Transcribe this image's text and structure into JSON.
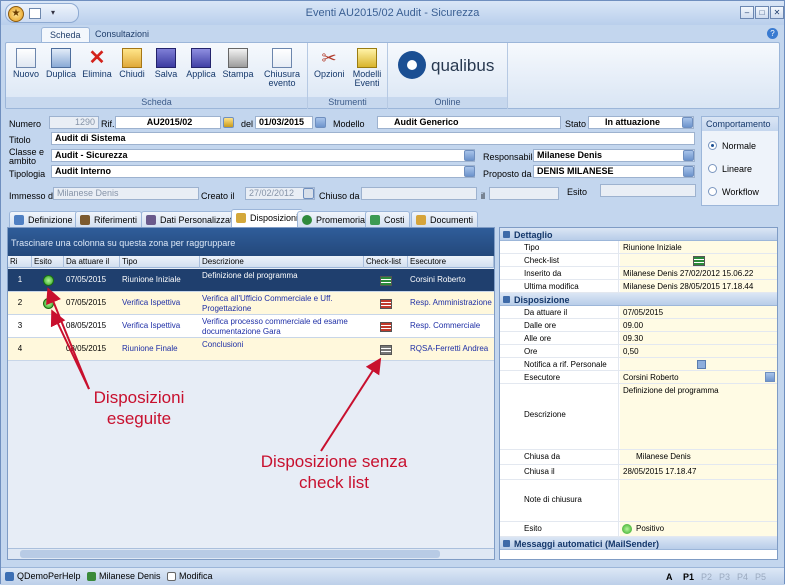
{
  "window": {
    "title": "Eventi AU2015/02 Audit - Sicurezza"
  },
  "ribbon_tabs": [
    "Scheda",
    "Consultazioni"
  ],
  "ribbon": {
    "groups": [
      {
        "label": "Scheda",
        "buttons": [
          "Nuovo",
          "Duplica",
          "Elimina",
          "Chiudi",
          "Salva",
          "Applica",
          "Stampa",
          "Chiusura evento"
        ]
      },
      {
        "label": "Strumenti",
        "buttons": [
          "Opzioni",
          "Modelli Eventi"
        ]
      },
      {
        "label": "Online"
      }
    ],
    "logo_text": "qualibus"
  },
  "form": {
    "numero_label": "Numero",
    "numero": "1290",
    "rif_label": "Rif.",
    "rif": "AU2015/02",
    "del_label": "del",
    "del": "01/03/2015",
    "modello_label": "Modello",
    "modello": "Audit Generico",
    "stato_label": "Stato",
    "stato": "In attuazione",
    "titolo_label": "Titolo",
    "titolo": "Audit di Sistema",
    "classe_label": "Classe e ambito",
    "classe": "Audit - Sicurezza",
    "tipologia_label": "Tipologia",
    "tipologia": "Audit Interno",
    "responsabile_label": "Responsabile",
    "responsabile": "Milanese Denis",
    "proposto_label": "Proposto da",
    "proposto": "DENIS MILANESE",
    "immesso_label": "Immesso da",
    "immesso": "Milanese Denis",
    "creato_label": "Creato il",
    "creato": "27/02/2012",
    "chiuso_label": "Chiuso da",
    "chiuso": "",
    "il_label": "il",
    "il": "",
    "esito_label": "Esito",
    "esito": ""
  },
  "comportamento": {
    "title": "Comportamento",
    "options": [
      "Normale",
      "Lineare",
      "Workflow"
    ],
    "selected": "Normale"
  },
  "page_tabs": [
    "Definizione",
    "Riferimenti",
    "Dati Personalizzati",
    "Disposizioni",
    "Promemoria",
    "Costi",
    "Documenti"
  ],
  "active_tab": "Disposizioni",
  "grid": {
    "group_hint": "Trascinare una colonna su questa zona per raggruppare",
    "headers": [
      "Ri",
      "Esito",
      "Da attuare il",
      "Tipo",
      "Descrizione",
      "Check-list",
      "Esecutore"
    ],
    "rows": [
      {
        "n": "1",
        "esito": true,
        "data": "07/05/2015",
        "tipo": "Riunione Iniziale",
        "descr": "Definizione del programma",
        "check": "green",
        "esec": "Corsini Roberto"
      },
      {
        "n": "2",
        "esito": true,
        "data": "07/05/2015",
        "tipo": "Verifica Ispettiva",
        "descr": "Verifica all'Ufficio Commerciale e Uff. Progettazione",
        "check": "red",
        "esec": "Resp. Amministrazione"
      },
      {
        "n": "3",
        "esito": false,
        "data": "08/05/2015",
        "tipo": "Verifica Ispettiva",
        "descr": "Verifica processo commerciale ed esame documentazione Gara",
        "check": "red",
        "esec": "Resp. Commerciale"
      },
      {
        "n": "4",
        "esito": false,
        "data": "08/05/2015",
        "tipo": "Riunione Finale",
        "descr": "Conclusioni",
        "check": "gray",
        "esec": "RQSA-Ferretti Andrea"
      }
    ]
  },
  "details": {
    "dettaglio_title": "Dettaglio",
    "dettaglio": [
      {
        "k": "Tipo",
        "v": "Riunione Iniziale"
      },
      {
        "k": "Check-list",
        "v": ""
      },
      {
        "k": "Inserito da",
        "v": "Milanese Denis   27/02/2012 15.06.22"
      },
      {
        "k": "Ultima modifica",
        "v": "Milanese Denis   28/05/2015 17.18.44"
      }
    ],
    "disposizione_title": "Disposizione",
    "disposizione": [
      {
        "k": "Da attuare il",
        "v": "07/05/2015"
      },
      {
        "k": "Dalle ore",
        "v": "09.00"
      },
      {
        "k": "Alle ore",
        "v": "09.30"
      },
      {
        "k": "Ore",
        "v": "0,50"
      },
      {
        "k": "Notifica a rif. Personale",
        "v": ""
      },
      {
        "k": "Esecutore",
        "v": "Corsini Roberto"
      }
    ],
    "descrizione_label": "Descrizione",
    "descrizione": "Definizione del programma",
    "chiusa_da_label": "Chiusa da",
    "chiusa_da": "Milanese Denis",
    "chiusa_il_label": "Chiusa il",
    "chiusa_il": "28/05/2015 17.18.47",
    "note_label": "Note di chiusura",
    "note": "",
    "esito_label": "Esito",
    "esito": "Positivo",
    "messaggi": "Messaggi automatici (MailSender)"
  },
  "statusbar": {
    "items": [
      "QDemoPerHelp",
      "Milanese Denis",
      "Modifica"
    ],
    "pages": [
      "A",
      "P1",
      "P2",
      "P3",
      "P4",
      "P5"
    ]
  },
  "annotations": {
    "a1": "Disposizioni eseguite",
    "a2": "Disposizione senza check list"
  }
}
